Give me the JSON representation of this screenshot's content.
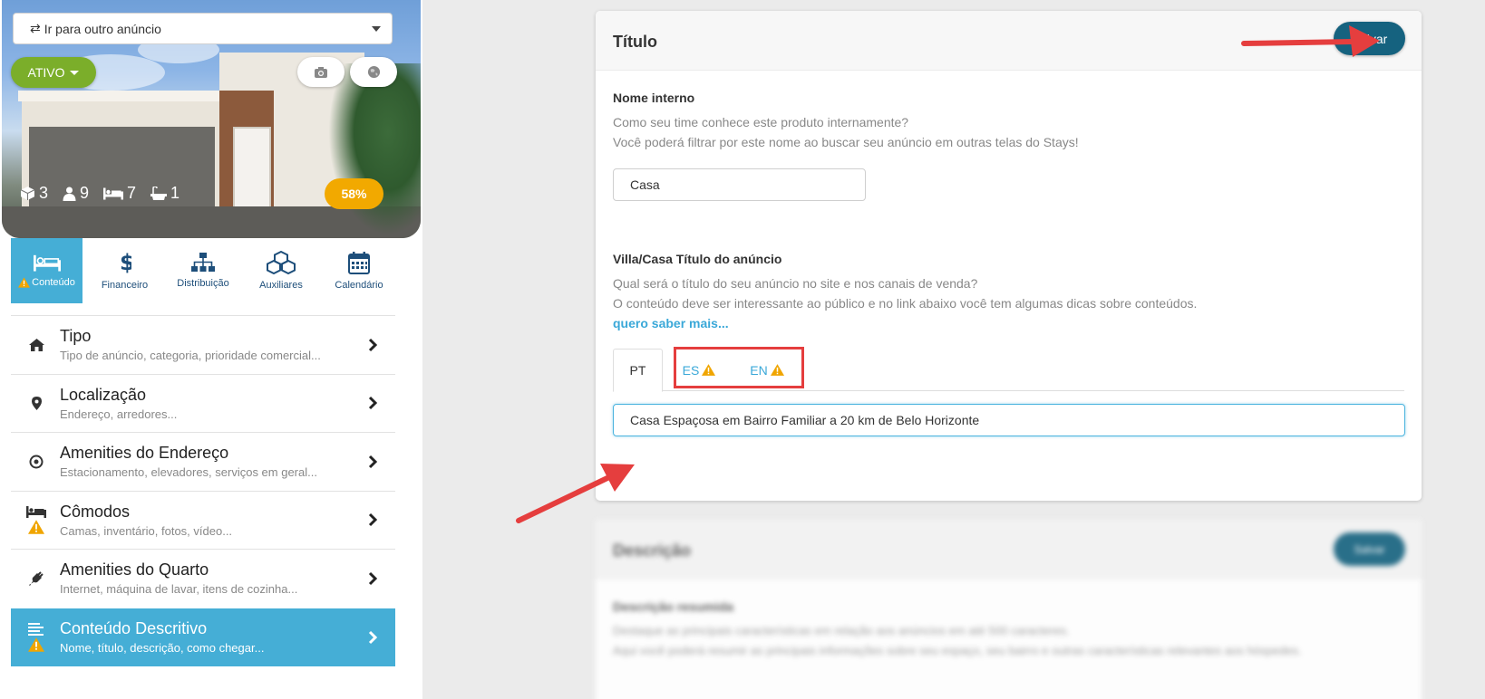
{
  "listing": {
    "goto_label": "Ir para outro anúncio",
    "status": "ATIVO",
    "stats": {
      "units": "3",
      "guests": "9",
      "beds": "7",
      "baths": "1"
    },
    "completion": "58%"
  },
  "tabs": [
    {
      "label": "Conteúdo",
      "icon": "bed-icon",
      "active": true,
      "warning": true
    },
    {
      "label": "Financeiro",
      "icon": "dollar-icon"
    },
    {
      "label": "Distribuição",
      "icon": "sitemap-icon"
    },
    {
      "label": "Auxiliares",
      "icon": "cubes-icon"
    },
    {
      "label": "Calendário",
      "icon": "calendar-icon"
    }
  ],
  "menu": [
    {
      "title": "Tipo",
      "subtitle": "Tipo de anúncio, categoria, prioridade comercial...",
      "icon": "home-icon"
    },
    {
      "title": "Localização",
      "subtitle": "Endereço, arredores...",
      "icon": "map-pin-icon"
    },
    {
      "title": "Amenities do Endereço",
      "subtitle": "Estacionamento, elevadores, serviços em geral...",
      "icon": "target-icon"
    },
    {
      "title": "Cômodos",
      "subtitle": "Camas, inventário, fotos, vídeo...",
      "icon": "bed-icon",
      "warning": true
    },
    {
      "title": "Amenities do Quarto",
      "subtitle": "Internet, máquina de lavar, itens de cozinha...",
      "icon": "plug-icon"
    },
    {
      "title": "Conteúdo Descritivo",
      "subtitle": "Nome, título, descrição, como chegar...",
      "icon": "align-left-icon",
      "warning": true,
      "active": true
    }
  ],
  "title_card": {
    "heading": "Título",
    "save_label": "Salvar",
    "internal_name_label": "Nome interno",
    "internal_name_help_1": "Como seu time conhece este produto internamente?",
    "internal_name_help_2": "Você poderá filtrar por este nome ao buscar seu anúncio em outras telas do Stays!",
    "internal_name_value": "Casa",
    "listing_title_label": "Villa/Casa Título do anúncio",
    "listing_title_help_1": "Qual será o título do seu anúncio no site e nos canais de venda?",
    "listing_title_help_2": "O conteúdo deve ser interessante ao público e no link abaixo você tem algumas dicas sobre conteúdos.",
    "more_link": "quero saber mais...",
    "languages": [
      "PT",
      "ES",
      "EN"
    ],
    "listing_title_value": "Casa Espaçosa em Bairro Familiar a 20 km de Belo Horizonte"
  },
  "description_card": {
    "heading": "Descrição",
    "save_label": "Salvar",
    "summary_label": "Descrição resumida",
    "summary_help_1": "Destaque as principais características em relação aos anúncios em até 500 caracteres.",
    "summary_help_2": "Aqui você poderá resumir as principais informações sobre seu espaço, seu bairro e outras características relevantes aos hóspedes."
  },
  "colors": {
    "accent": "#45aed6",
    "save": "#15627f",
    "status": "#7bae2a",
    "progress": "#f2a900",
    "warning": "#f0a500",
    "annotation": "#e53e3e"
  }
}
